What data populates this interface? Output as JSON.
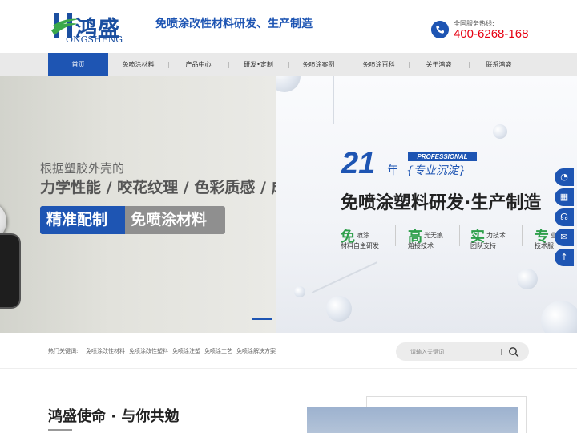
{
  "header": {
    "logo_cn": "鸿盛",
    "logo_en": "ONGSHENG",
    "slogan": "免喷涂改性材料研发、生产制造",
    "hotline_label": "全国服务热线:",
    "hotline_number": "400-6268-168"
  },
  "nav": {
    "items": [
      {
        "label": "首页"
      },
      {
        "label": "免喷涂材料"
      },
      {
        "label": "产品中心"
      },
      {
        "label": "研发•定制"
      },
      {
        "label": "免喷涂案例"
      },
      {
        "label": "免喷涂百科"
      },
      {
        "label": "关于鸿盛"
      },
      {
        "label": "联系鸿盛"
      }
    ]
  },
  "banner_left": {
    "line1": "根据塑胶外壳的",
    "line2": "力学性能 / 咬花纹理 / 色彩质感 / 成",
    "pill_a": "精准配制",
    "pill_b": "免喷涂材料"
  },
  "banner_right": {
    "years": "21",
    "year_unit": "年",
    "professional": "PROFESSIONAL",
    "specialty": "{专业沉淀}",
    "title": "免喷涂塑料研发·生产制造",
    "features": [
      {
        "big": "免",
        "small": "喷涂",
        "sub": "材料自主研发"
      },
      {
        "big": "高",
        "small": "光无痕",
        "sub": "熔接技术"
      },
      {
        "big": "实",
        "small": "力技术",
        "sub": "团队支持"
      },
      {
        "big": "专",
        "small": "业",
        "sub": "技术服"
      }
    ]
  },
  "side_tools": [
    {
      "icon": "qq-icon",
      "glyph": "◔"
    },
    {
      "icon": "qrcode-icon",
      "glyph": "▦"
    },
    {
      "icon": "headset-icon",
      "glyph": "☊"
    },
    {
      "icon": "mail-icon",
      "glyph": "✉"
    },
    {
      "icon": "back-to-top-icon",
      "glyph": "↑"
    }
  ],
  "search": {
    "hot_label": "热门关键词:",
    "keywords": [
      "免喷涂改性材料",
      "免喷涂改性塑料",
      "免喷涂注塑",
      "免喷涂工艺",
      "免喷涂解决方案"
    ],
    "placeholder": "请输入关键词"
  },
  "mission": {
    "title": "鸿盛使命 · 与你共勉"
  },
  "colors": {
    "brand_blue": "#1e55b3",
    "hotline_red": "#e60012",
    "feature_green": "#2e9f4b"
  }
}
